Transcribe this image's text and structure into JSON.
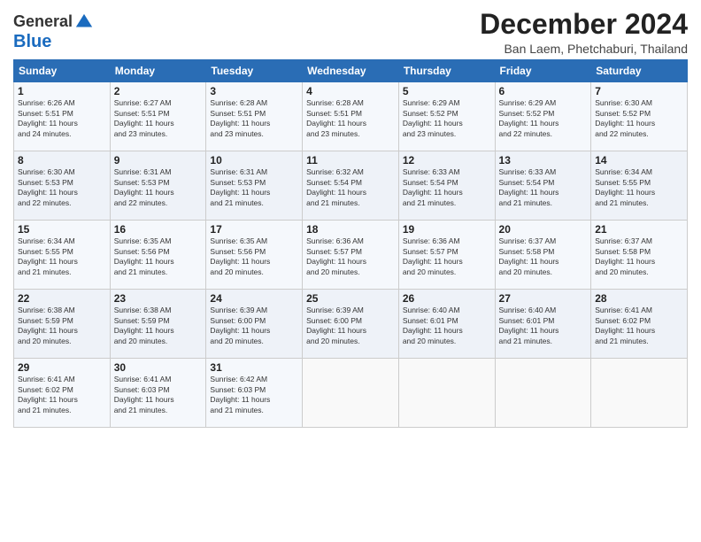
{
  "header": {
    "logo_general": "General",
    "logo_blue": "Blue",
    "month": "December 2024",
    "location": "Ban Laem, Phetchaburi, Thailand"
  },
  "weekdays": [
    "Sunday",
    "Monday",
    "Tuesday",
    "Wednesday",
    "Thursday",
    "Friday",
    "Saturday"
  ],
  "weeks": [
    [
      {
        "day": "1",
        "info": "Sunrise: 6:26 AM\nSunset: 5:51 PM\nDaylight: 11 hours\nand 24 minutes."
      },
      {
        "day": "2",
        "info": "Sunrise: 6:27 AM\nSunset: 5:51 PM\nDaylight: 11 hours\nand 23 minutes."
      },
      {
        "day": "3",
        "info": "Sunrise: 6:28 AM\nSunset: 5:51 PM\nDaylight: 11 hours\nand 23 minutes."
      },
      {
        "day": "4",
        "info": "Sunrise: 6:28 AM\nSunset: 5:51 PM\nDaylight: 11 hours\nand 23 minutes."
      },
      {
        "day": "5",
        "info": "Sunrise: 6:29 AM\nSunset: 5:52 PM\nDaylight: 11 hours\nand 23 minutes."
      },
      {
        "day": "6",
        "info": "Sunrise: 6:29 AM\nSunset: 5:52 PM\nDaylight: 11 hours\nand 22 minutes."
      },
      {
        "day": "7",
        "info": "Sunrise: 6:30 AM\nSunset: 5:52 PM\nDaylight: 11 hours\nand 22 minutes."
      }
    ],
    [
      {
        "day": "8",
        "info": "Sunrise: 6:30 AM\nSunset: 5:53 PM\nDaylight: 11 hours\nand 22 minutes."
      },
      {
        "day": "9",
        "info": "Sunrise: 6:31 AM\nSunset: 5:53 PM\nDaylight: 11 hours\nand 22 minutes."
      },
      {
        "day": "10",
        "info": "Sunrise: 6:31 AM\nSunset: 5:53 PM\nDaylight: 11 hours\nand 21 minutes."
      },
      {
        "day": "11",
        "info": "Sunrise: 6:32 AM\nSunset: 5:54 PM\nDaylight: 11 hours\nand 21 minutes."
      },
      {
        "day": "12",
        "info": "Sunrise: 6:33 AM\nSunset: 5:54 PM\nDaylight: 11 hours\nand 21 minutes."
      },
      {
        "day": "13",
        "info": "Sunrise: 6:33 AM\nSunset: 5:54 PM\nDaylight: 11 hours\nand 21 minutes."
      },
      {
        "day": "14",
        "info": "Sunrise: 6:34 AM\nSunset: 5:55 PM\nDaylight: 11 hours\nand 21 minutes."
      }
    ],
    [
      {
        "day": "15",
        "info": "Sunrise: 6:34 AM\nSunset: 5:55 PM\nDaylight: 11 hours\nand 21 minutes."
      },
      {
        "day": "16",
        "info": "Sunrise: 6:35 AM\nSunset: 5:56 PM\nDaylight: 11 hours\nand 21 minutes."
      },
      {
        "day": "17",
        "info": "Sunrise: 6:35 AM\nSunset: 5:56 PM\nDaylight: 11 hours\nand 20 minutes."
      },
      {
        "day": "18",
        "info": "Sunrise: 6:36 AM\nSunset: 5:57 PM\nDaylight: 11 hours\nand 20 minutes."
      },
      {
        "day": "19",
        "info": "Sunrise: 6:36 AM\nSunset: 5:57 PM\nDaylight: 11 hours\nand 20 minutes."
      },
      {
        "day": "20",
        "info": "Sunrise: 6:37 AM\nSunset: 5:58 PM\nDaylight: 11 hours\nand 20 minutes."
      },
      {
        "day": "21",
        "info": "Sunrise: 6:37 AM\nSunset: 5:58 PM\nDaylight: 11 hours\nand 20 minutes."
      }
    ],
    [
      {
        "day": "22",
        "info": "Sunrise: 6:38 AM\nSunset: 5:59 PM\nDaylight: 11 hours\nand 20 minutes."
      },
      {
        "day": "23",
        "info": "Sunrise: 6:38 AM\nSunset: 5:59 PM\nDaylight: 11 hours\nand 20 minutes."
      },
      {
        "day": "24",
        "info": "Sunrise: 6:39 AM\nSunset: 6:00 PM\nDaylight: 11 hours\nand 20 minutes."
      },
      {
        "day": "25",
        "info": "Sunrise: 6:39 AM\nSunset: 6:00 PM\nDaylight: 11 hours\nand 20 minutes."
      },
      {
        "day": "26",
        "info": "Sunrise: 6:40 AM\nSunset: 6:01 PM\nDaylight: 11 hours\nand 20 minutes."
      },
      {
        "day": "27",
        "info": "Sunrise: 6:40 AM\nSunset: 6:01 PM\nDaylight: 11 hours\nand 21 minutes."
      },
      {
        "day": "28",
        "info": "Sunrise: 6:41 AM\nSunset: 6:02 PM\nDaylight: 11 hours\nand 21 minutes."
      }
    ],
    [
      {
        "day": "29",
        "info": "Sunrise: 6:41 AM\nSunset: 6:02 PM\nDaylight: 11 hours\nand 21 minutes."
      },
      {
        "day": "30",
        "info": "Sunrise: 6:41 AM\nSunset: 6:03 PM\nDaylight: 11 hours\nand 21 minutes."
      },
      {
        "day": "31",
        "info": "Sunrise: 6:42 AM\nSunset: 6:03 PM\nDaylight: 11 hours\nand 21 minutes."
      },
      {
        "day": "",
        "info": ""
      },
      {
        "day": "",
        "info": ""
      },
      {
        "day": "",
        "info": ""
      },
      {
        "day": "",
        "info": ""
      }
    ]
  ]
}
